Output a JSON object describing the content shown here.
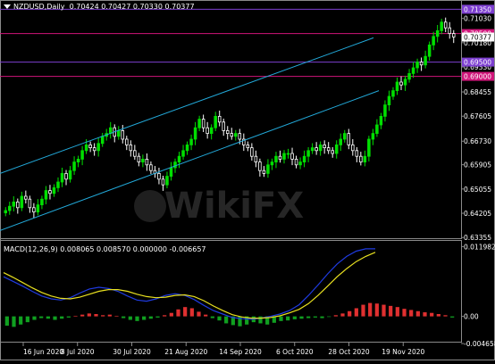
{
  "header": {
    "symbol": "NZDUSD,Daily",
    "ohlc": "0.70424 0.70427 0.70330 0.70377"
  },
  "macd_header": {
    "label": "MACD(12,26,9) 0.008065 0.008570 0.000000 -0.006657"
  },
  "watermark": "WikiFX",
  "colors": {
    "background": "#000000",
    "bull_candle": "#00e000",
    "bear_candle": "#ffffff",
    "channel": "#22a8d8",
    "level_line": "#d0157a",
    "level_line_purple": "#7d3fd0",
    "macd_fast": "#1f3be0",
    "macd_signal": "#e8e020",
    "hist_pos": "#e03030",
    "hist_neg": "#10a020"
  },
  "chart_data": [
    {
      "type": "candlestick",
      "symbol": "NZDUSD",
      "timeframe": "Daily",
      "ylim": [
        0.633,
        0.713
      ],
      "yticks": [
        "0.71030",
        "0.70180",
        "0.69330",
        "0.68455",
        "0.67605",
        "0.66730",
        "0.65905",
        "0.65055",
        "0.64205",
        "0.63355"
      ],
      "xticks": [
        "16 Jun 2020",
        "8 Jul 2020",
        "30 Jul 2020",
        "21 Aug 2020",
        "14 Sep 2020",
        "6 Oct 2020",
        "28 Oct 2020",
        "19 Nov 2020"
      ],
      "level_labels": [
        {
          "value": 0.7135,
          "text": "0.71350",
          "color": "#7d3fd0"
        },
        {
          "value": 0.705,
          "text": "0.70500",
          "color": "#d0157a"
        },
        {
          "value": 0.70377,
          "text": "0.70377",
          "color": "#ffffff"
        },
        {
          "value": 0.695,
          "text": "0.69500",
          "color": "#7d3fd0"
        },
        {
          "value": 0.69,
          "text": "0.69000",
          "color": "#d0157a"
        }
      ],
      "closes": [
        0.643,
        0.6445,
        0.646,
        0.644,
        0.648,
        0.647,
        0.644,
        0.6425,
        0.645,
        0.647,
        0.65,
        0.649,
        0.651,
        0.653,
        0.656,
        0.654,
        0.657,
        0.66,
        0.661,
        0.664,
        0.666,
        0.665,
        0.664,
        0.6665,
        0.669,
        0.67,
        0.672,
        0.669,
        0.671,
        0.668,
        0.666,
        0.664,
        0.662,
        0.66,
        0.661,
        0.659,
        0.657,
        0.656,
        0.654,
        0.652,
        0.655,
        0.658,
        0.66,
        0.662,
        0.664,
        0.666,
        0.668,
        0.672,
        0.675,
        0.672,
        0.67,
        0.672,
        0.676,
        0.674,
        0.671,
        0.67,
        0.669,
        0.67,
        0.668,
        0.666,
        0.665,
        0.662,
        0.66,
        0.657,
        0.656,
        0.659,
        0.66,
        0.662,
        0.661,
        0.663,
        0.663,
        0.661,
        0.659,
        0.66,
        0.662,
        0.664,
        0.665,
        0.664,
        0.666,
        0.665,
        0.664,
        0.663,
        0.666,
        0.668,
        0.67,
        0.666,
        0.664,
        0.662,
        0.66,
        0.662,
        0.668,
        0.67,
        0.673,
        0.676,
        0.68,
        0.683,
        0.685,
        0.688,
        0.687,
        0.689,
        0.691,
        0.693,
        0.695,
        0.694,
        0.697,
        0.701,
        0.704,
        0.706,
        0.709,
        0.707,
        0.705,
        0.7038
      ]
    },
    {
      "type": "line",
      "name": "MACD(12,26,9)",
      "ylim": [
        -0.0045,
        0.0125
      ],
      "yticks": [
        "0.011982",
        "0.00",
        "-0.004658"
      ],
      "series": [
        {
          "name": "MACD",
          "color": "#1f3be0",
          "values": [
            0.0068,
            0.006,
            0.0052,
            0.0043,
            0.0035,
            0.003,
            0.0028,
            0.0032,
            0.004,
            0.0047,
            0.005,
            0.0048,
            0.0043,
            0.0035,
            0.0028,
            0.0026,
            0.003,
            0.0036,
            0.0039,
            0.0036,
            0.0029,
            0.0019,
            0.001,
            0.0004,
            -0.0002,
            -0.0004,
            -0.0005,
            -0.0003,
            0.0,
            0.0004,
            0.001,
            0.002,
            0.0036,
            0.0054,
            0.0073,
            0.009,
            0.0103,
            0.0112,
            0.0116,
            0.0116
          ]
        },
        {
          "name": "Signal",
          "color": "#e8e020",
          "values": [
            0.0075,
            0.0067,
            0.0058,
            0.0049,
            0.0041,
            0.0035,
            0.0031,
            0.003,
            0.0033,
            0.0038,
            0.0043,
            0.0046,
            0.0046,
            0.0043,
            0.0038,
            0.0034,
            0.0032,
            0.0033,
            0.0036,
            0.0037,
            0.0034,
            0.0027,
            0.0018,
            0.001,
            0.0003,
            -0.0001,
            -0.0003,
            -0.0003,
            -0.0002,
            0.0001,
            0.0006,
            0.0012,
            0.0022,
            0.0036,
            0.0052,
            0.0068,
            0.0082,
            0.0094,
            0.0103,
            0.011
          ]
        }
      ],
      "histogram": [
        -0.0016,
        -0.0018,
        -0.0014,
        -0.001,
        -0.0006,
        -0.0003,
        -0.0004,
        -0.0006,
        -0.0004,
        -0.0002,
        0.0001,
        0.0003,
        0.0005,
        0.0004,
        0.0002,
        0.0003,
        0.0001,
        -0.0003,
        -0.0006,
        -0.0008,
        -0.0006,
        -0.0004,
        -0.0002,
        0.0002,
        0.0006,
        0.0012,
        0.0016,
        0.0014,
        0.0008,
        0.0003,
        -0.0003,
        -0.0007,
        -0.0012,
        -0.0015,
        -0.0017,
        -0.0014,
        -0.001,
        -0.0012,
        -0.0014,
        -0.0011,
        -0.0008,
        -0.0007,
        -0.0005,
        -0.0004,
        -0.0003,
        -0.0002,
        -0.0003,
        -0.0001,
        0.0002,
        0.0005,
        0.0009,
        0.0014,
        0.002,
        0.0023,
        0.0022,
        0.002,
        0.0018,
        0.0016,
        0.0013,
        0.0011,
        0.0009,
        0.0007,
        0.0006,
        0.0004,
        0.0002,
        -0.0002
      ]
    }
  ]
}
